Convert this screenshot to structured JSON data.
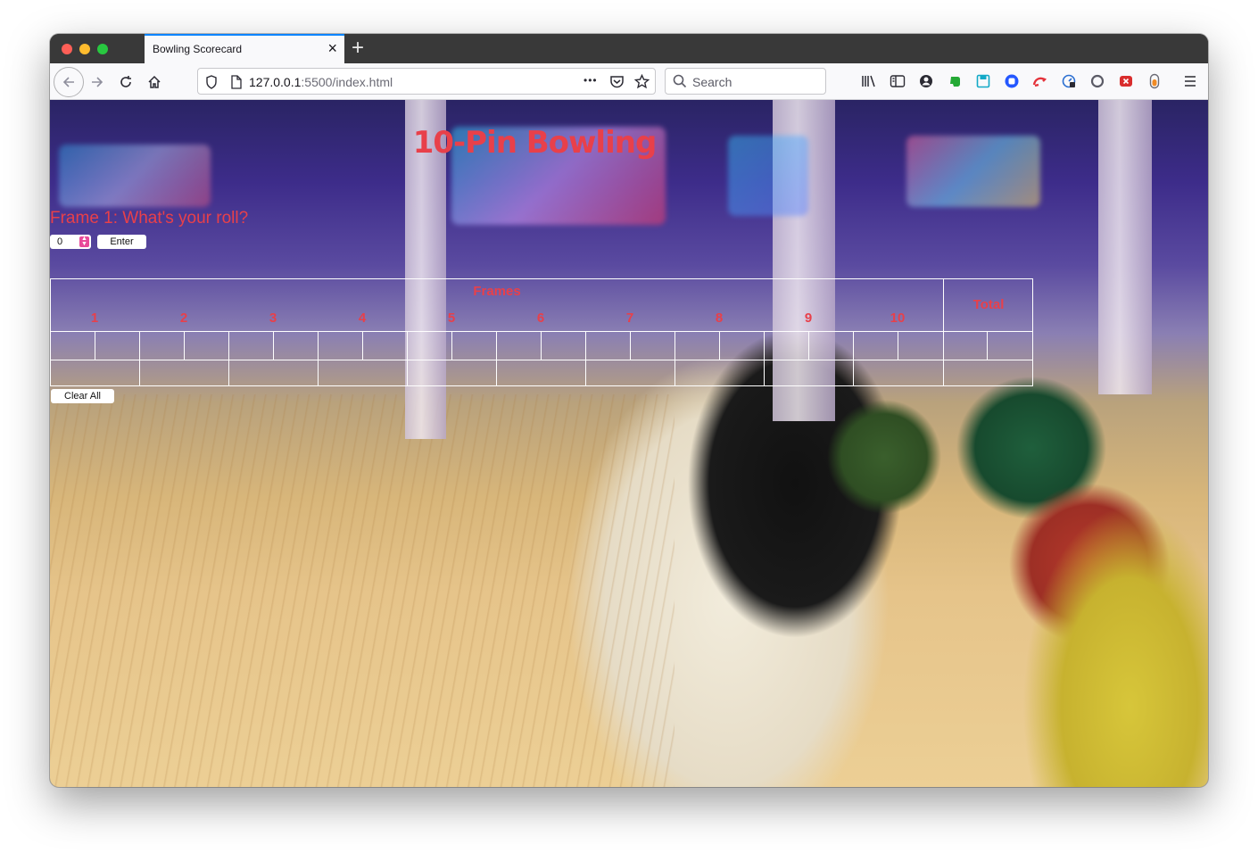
{
  "browser": {
    "tab_title": "Bowling Scorecard",
    "tab_close": "×",
    "new_tab": "+",
    "url_host": "127.0.0.1",
    "url_rest": ":5500/index.html",
    "search_placeholder": "Search",
    "page_actions": "•••"
  },
  "page": {
    "title": "10-Pin Bowling",
    "prompt": "Frame 1: What's your roll?",
    "roll_value": "0",
    "enter_label": "Enter",
    "clear_label": "Clear All"
  },
  "scorecard": {
    "frames_header": "Frames",
    "total_header": "Total",
    "frame_numbers": [
      "1",
      "2",
      "3",
      "4",
      "5",
      "6",
      "7",
      "8",
      "9",
      "10"
    ]
  },
  "colors": {
    "accent": "#e8404a",
    "tab_highlight": "#0a84ff"
  }
}
